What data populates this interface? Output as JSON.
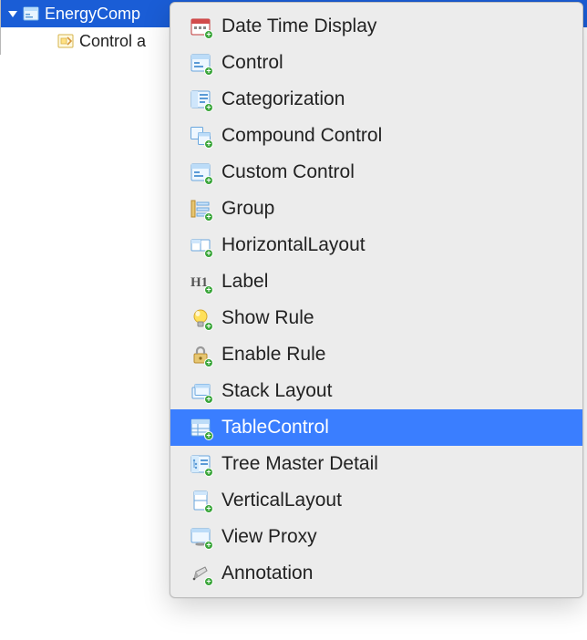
{
  "tree": {
    "root": {
      "label": "EnergyComp",
      "expanded": true
    },
    "child": {
      "label": "Control a"
    }
  },
  "menu": {
    "items": [
      {
        "label": "Date Time Display",
        "icon": "calendar-icon"
      },
      {
        "label": "Control",
        "icon": "control-icon"
      },
      {
        "label": "Categorization",
        "icon": "categorization-icon"
      },
      {
        "label": "Compound Control",
        "icon": "compound-control-icon"
      },
      {
        "label": "Custom Control",
        "icon": "custom-control-icon"
      },
      {
        "label": "Group",
        "icon": "group-icon"
      },
      {
        "label": "HorizontalLayout",
        "icon": "horizontal-layout-icon"
      },
      {
        "label": "Label",
        "icon": "label-icon"
      },
      {
        "label": "Show Rule",
        "icon": "show-rule-icon"
      },
      {
        "label": "Enable Rule",
        "icon": "enable-rule-icon"
      },
      {
        "label": "Stack Layout",
        "icon": "stack-layout-icon"
      },
      {
        "label": "TableControl",
        "icon": "table-control-icon",
        "highlight": true
      },
      {
        "label": "Tree Master Detail",
        "icon": "tree-master-detail-icon"
      },
      {
        "label": "VerticalLayout",
        "icon": "vertical-layout-icon"
      },
      {
        "label": "View Proxy",
        "icon": "view-proxy-icon"
      },
      {
        "label": "Annotation",
        "icon": "annotation-icon"
      }
    ]
  }
}
